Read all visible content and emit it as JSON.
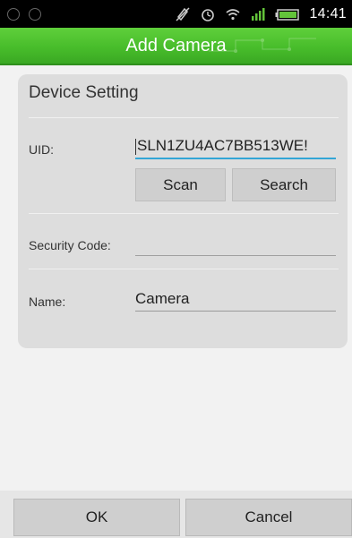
{
  "status_bar": {
    "time": "14:41",
    "left_icons": [
      "notification-icon",
      "notification-icon"
    ],
    "right_icons": [
      "silent-icon",
      "alarm-icon",
      "wifi-icon",
      "signal-icon",
      "battery-icon"
    ]
  },
  "header": {
    "title": "Add Camera",
    "color": "#48bd2b"
  },
  "form": {
    "section_title": "Device Setting",
    "uid_label": "UID:",
    "uid_value": "SLN1ZU4AC7BB513WE!",
    "scan_label": "Scan",
    "search_label": "Search",
    "security_label": "Security Code:",
    "security_value": "",
    "name_label": "Name:",
    "name_value": "Camera"
  },
  "footer": {
    "ok_label": "OK",
    "cancel_label": "Cancel"
  }
}
